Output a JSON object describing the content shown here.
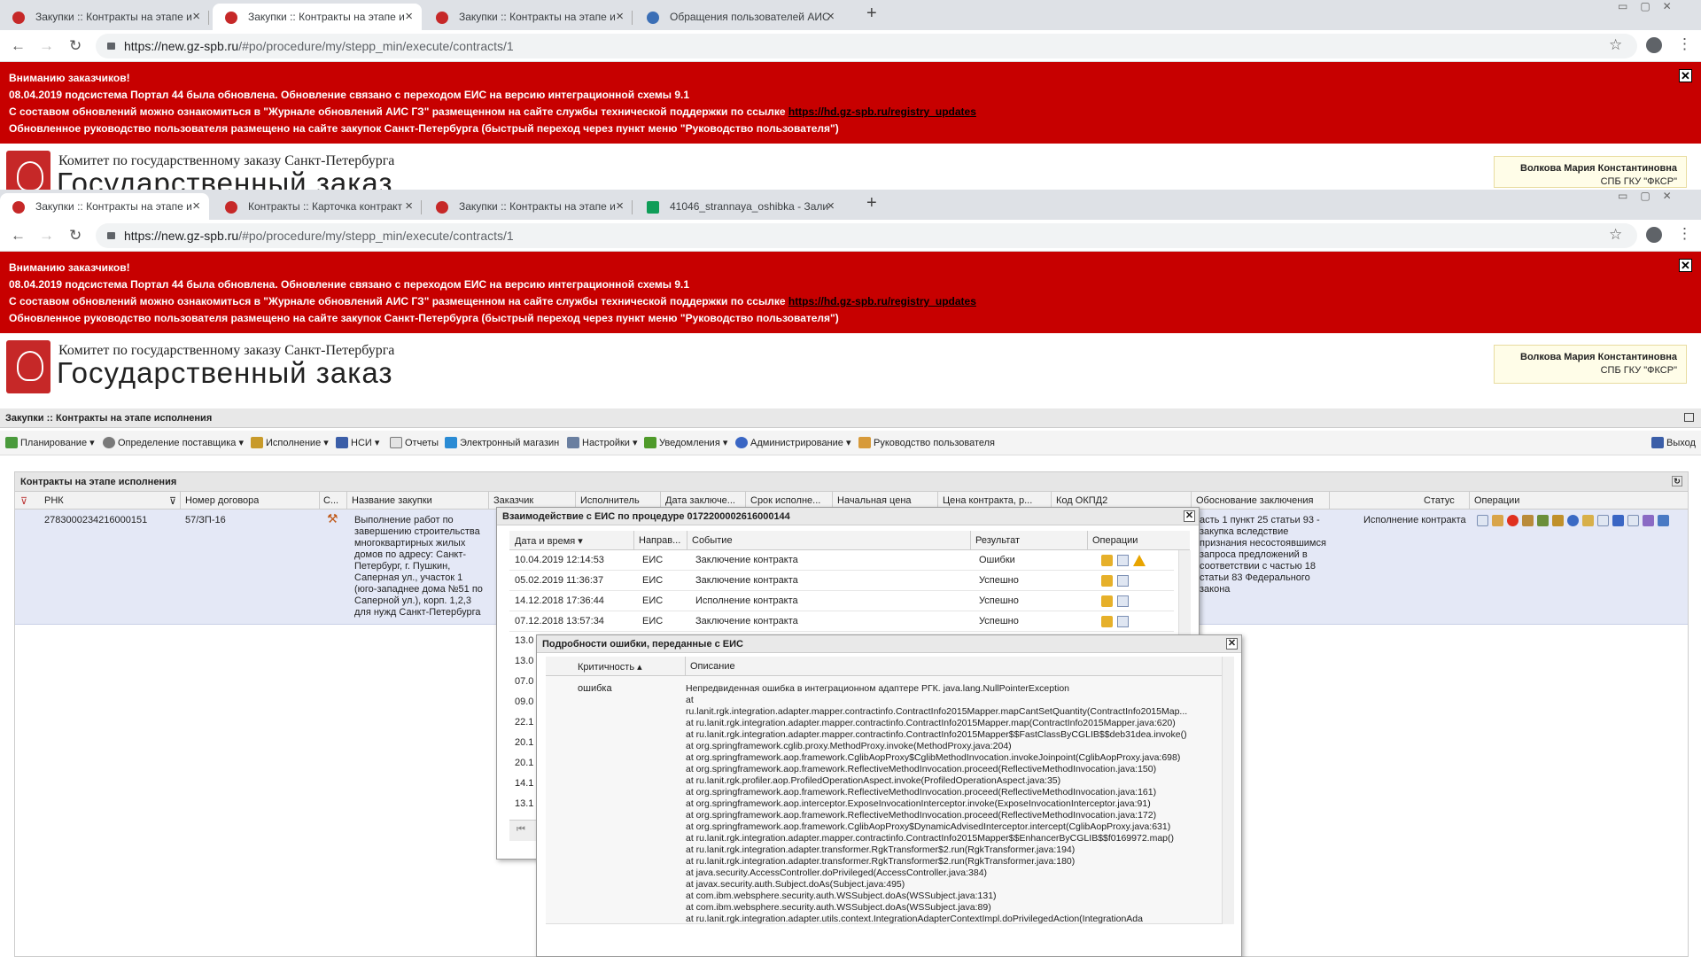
{
  "browser_back": {
    "tabs": [
      {
        "label": "Закупки :: Контракты на этапе и"
      },
      {
        "label": "Закупки :: Контракты на этапе и"
      },
      {
        "label": "Закупки :: Контракты на этапе и"
      },
      {
        "label": "Обращения пользователей АИС"
      }
    ],
    "url_host": "https://new.gz-spb.ru",
    "url_path": "/#po/procedure/my/stepp_min/execute/contracts/1"
  },
  "browser_front": {
    "tabs": [
      {
        "label": "Закупки :: Контракты на этапе и"
      },
      {
        "label": "Контракты :: Карточка контракт"
      },
      {
        "label": "Закупки :: Контракты на этапе и"
      },
      {
        "label": "41046_strannaya_oshibka - Зали"
      }
    ],
    "url_host": "https://new.gz-spb.ru",
    "url_path": "/#po/procedure/my/stepp_min/execute/contracts/1"
  },
  "banner": {
    "line1": "Вниманию заказчиков!",
    "line2": "08.04.2019 подсистема Портал 44 была обновлена. Обновление связано с переходом ЕИС на версию интеграционной схемы 9.1",
    "line3": "С составом обновлений можно ознакомиться в \"Журнале обновлений АИС ГЗ\" размещенном на сайте службы технической поддержки по ссылке",
    "link": "https://hd.gz-spb.ru/registry_updates",
    "line4": "Обновленное руководство пользователя размещено на сайте закупок Санкт-Петербурга (быстрый переход через пункт меню \"Руководство пользователя\")"
  },
  "header": {
    "org_line1": "Комитет по государственному заказу Санкт-Петербурга",
    "org_line2": "Государственный заказ",
    "user_name": "Волкова Мария Константиновна",
    "user_org": "СПБ ГКУ \"ФКСР\""
  },
  "page_title": "Закупки :: Контракты на этапе исполнения",
  "menu": {
    "items": [
      "Планирование",
      "Определение поставщика",
      "Исполнение",
      "НСИ",
      "Отчеты",
      "Электронный магазин",
      "Настройки",
      "Уведомления",
      "Администрирование",
      "Руководство пользователя"
    ],
    "exit": "Выход"
  },
  "panel": {
    "title": "Контракты на этапе исполнения",
    "columns": [
      "РНК",
      "Номер договора",
      "С...",
      "Название закупки",
      "Заказчик",
      "Исполнитель",
      "Дата заключе...",
      "Срок исполне...",
      "Начальная цена",
      "Цена контракта, р...",
      "Код ОКПД2",
      "Обоснование заключения",
      "Статус",
      "Операции"
    ],
    "row": {
      "rnk": "2783000234216000151",
      "contract_no": "57/ЗП-16",
      "name": "Выполнение работ по завершению строительства многоквартирных жилых домов по адресу: Санкт-Петербург, г. Пушкин, Саперная ул., участок 1 (юго-западнее дома №51 по Саперной ул.), корп. 1,2,3 для нужд Санкт-Петербурга",
      "basis": "асть 1 пункт 25 статьи 93 - закупка вследствие признания несостоявшимся запроса предложений в соответствии с частью 18 статьи 83 Федерального закона",
      "status": "Исполнение контракта"
    }
  },
  "eis_dialog": {
    "title": "Взаимодействие с ЕИС по процедуре 0172200002616000144",
    "columns": [
      "Дата и время",
      "Направ...",
      "Событие",
      "Результат",
      "Операции"
    ],
    "rows": [
      {
        "date": "10.04.2019 12:14:53",
        "dir": "ЕИС",
        "event": "Заключение контракта",
        "result": "Ошибки"
      },
      {
        "date": "05.02.2019 11:36:37",
        "dir": "ЕИС",
        "event": "Заключение контракта",
        "result": "Успешно"
      },
      {
        "date": "14.12.2018 17:36:44",
        "dir": "ЕИС",
        "event": "Исполнение контракта",
        "result": "Успешно"
      },
      {
        "date": "07.12.2018 13:57:34",
        "dir": "ЕИС",
        "event": "Заключение контракта",
        "result": "Успешно"
      }
    ],
    "partial_dates": [
      "13.0",
      "13.0",
      "07.0",
      "09.0",
      "22.1",
      "20.1",
      "20.1",
      "14.1",
      "13.1"
    ]
  },
  "error_dialog": {
    "title": "Подробности ошибки, переданные с ЕИС",
    "columns": [
      "Критичность",
      "Описание"
    ],
    "severity": "ошибка",
    "trace": [
      "Непредвиденная ошибка в интеграционном адаптере РГК. java.lang.NullPointerException",
      "at",
      "ru.lanit.rgk.integration.adapter.mapper.contractinfo.ContractInfo2015Mapper.mapCantSetQuantity(ContractInfo2015Map...",
      "at ru.lanit.rgk.integration.adapter.mapper.contractinfo.ContractInfo2015Mapper.map(ContractInfo2015Mapper.java:620)",
      "at ru.lanit.rgk.integration.adapter.mapper.contractinfo.ContractInfo2015Mapper$$FastClassByCGLIB$$deb31dea.invoke()",
      "at org.springframework.cglib.proxy.MethodProxy.invoke(MethodProxy.java:204)",
      "at org.springframework.aop.framework.CglibAopProxy$CglibMethodInvocation.invokeJoinpoint(CglibAopProxy.java:698)",
      "at org.springframework.aop.framework.ReflectiveMethodInvocation.proceed(ReflectiveMethodInvocation.java:150)",
      "at ru.lanit.rgk.profiler.aop.ProfiledOperationAspect.invoke(ProfiledOperationAspect.java:35)",
      "at org.springframework.aop.framework.ReflectiveMethodInvocation.proceed(ReflectiveMethodInvocation.java:161)",
      "at org.springframework.aop.interceptor.ExposeInvocationInterceptor.invoke(ExposeInvocationInterceptor.java:91)",
      "at org.springframework.aop.framework.ReflectiveMethodInvocation.proceed(ReflectiveMethodInvocation.java:172)",
      "at org.springframework.aop.framework.CglibAopProxy$DynamicAdvisedInterceptor.intercept(CglibAopProxy.java:631)",
      "at ru.lanit.rgk.integration.adapter.mapper.contractinfo.ContractInfo2015Mapper$$EnhancerByCGLIB$$f0169972.map()",
      "at ru.lanit.rgk.integration.adapter.transformer.RgkTransformer$2.run(RgkTransformer.java:194)",
      "at ru.lanit.rgk.integration.adapter.transformer.RgkTransformer$2.run(RgkTransformer.java:180)",
      "at java.security.AccessController.doPrivileged(AccessController.java:384)",
      "at javax.security.auth.Subject.doAs(Subject.java:495)",
      "at com.ibm.websphere.security.auth.WSSubject.doAs(WSSubject.java:131)",
      "at com.ibm.websphere.security.auth.WSSubject.doAs(WSSubject.java:89)",
      "at ru.lanit.rgk.integration.adapter.utils.context.IntegrationAdapterContextImpl.doPrivilegedAction(IntegrationAda"
    ]
  },
  "colors": {
    "banner_red": "#c70000",
    "row_selected": "#e4e8f6"
  }
}
